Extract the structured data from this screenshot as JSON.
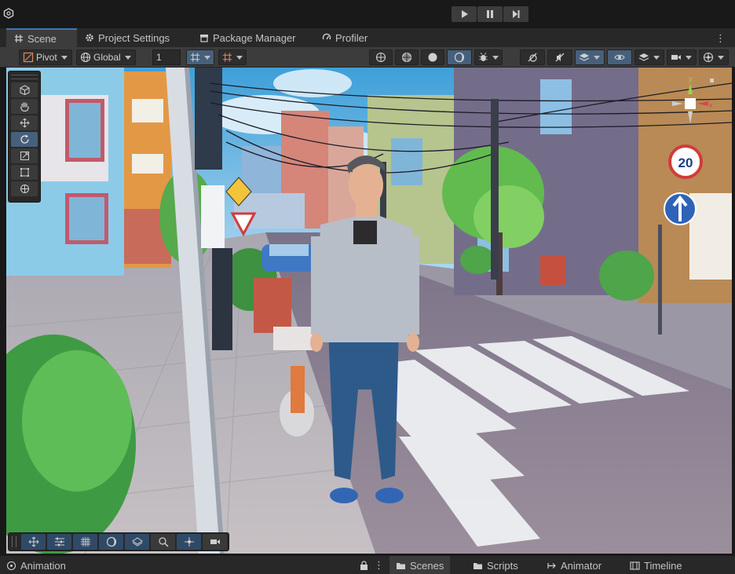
{
  "toolbar_play": {
    "buttons": [
      {
        "name": "play-button",
        "icon": "play-icon"
      },
      {
        "name": "pause-button",
        "icon": "pause-icon"
      },
      {
        "name": "step-button",
        "icon": "step-icon"
      }
    ]
  },
  "tabs": [
    {
      "label": "Scene",
      "icon": "grid-icon",
      "active": true
    },
    {
      "label": "Project Settings",
      "icon": "gear-icon",
      "active": false
    },
    {
      "label": "Package Manager",
      "icon": "package-icon",
      "active": false
    },
    {
      "label": "Profiler",
      "icon": "profiler-icon",
      "active": false
    }
  ],
  "scene_toolbar": {
    "pivot_label": "Pivot",
    "global_label": "Global",
    "grid_size": "1"
  },
  "bottom_tabs": {
    "animation": "Animation",
    "scenes": "Scenes",
    "scripts": "Scripts",
    "animator": "Animator",
    "timeline": "Timeline"
  },
  "colors": {
    "accent": "#3a79bb",
    "active_button": "#46607c",
    "panel": "#3c3c3c",
    "background": "#191919"
  }
}
